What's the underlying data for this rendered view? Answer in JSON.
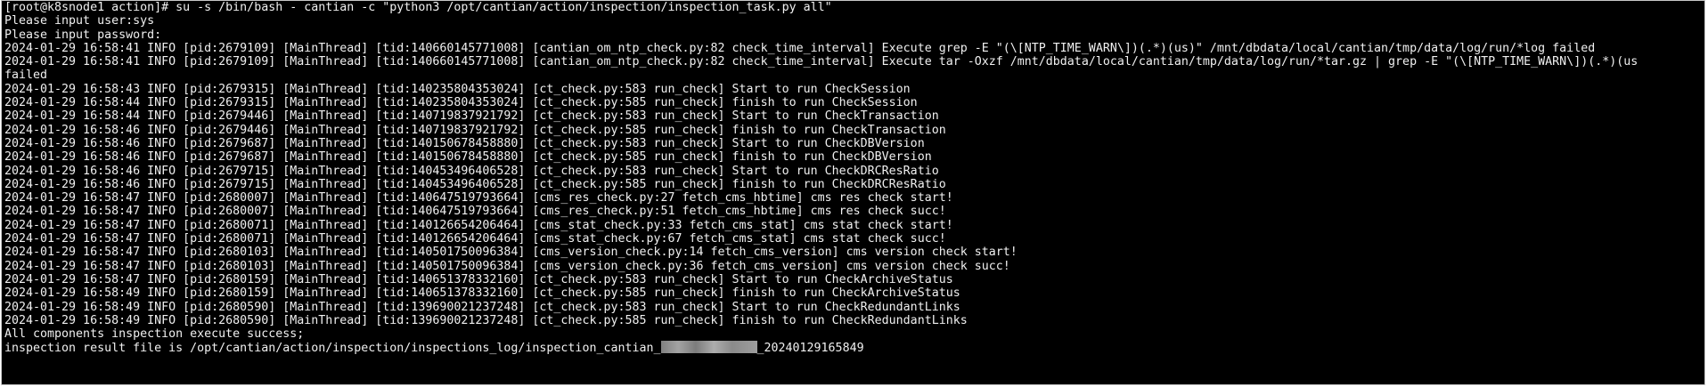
{
  "terminal": {
    "lines": [
      "[root@k8snode1 action]# su -s /bin/bash - cantian -c \"python3 /opt/cantian/action/inspection/inspection_task.py all\"",
      "Please input user:sys",
      "Please input password:",
      "2024-01-29 16:58:41 INFO [pid:2679109] [MainThread] [tid:140660145771008] [cantian_om_ntp_check.py:82 check_time_interval] Execute grep -E \"(\\[NTP_TIME_WARN\\])(.*)(us)\" /mnt/dbdata/local/cantian/tmp/data/log/run/*log failed",
      "2024-01-29 16:58:41 INFO [pid:2679109] [MainThread] [tid:140660145771008] [cantian_om_ntp_check.py:82 check_time_interval] Execute tar -Oxzf /mnt/dbdata/local/cantian/tmp/data/log/run/*tar.gz | grep -E \"(\\[NTP_TIME_WARN\\])(.*)(us",
      "failed",
      "2024-01-29 16:58:43 INFO [pid:2679315] [MainThread] [tid:140235804353024] [ct_check.py:583 run_check] Start to run CheckSession",
      "2024-01-29 16:58:44 INFO [pid:2679315] [MainThread] [tid:140235804353024] [ct_check.py:585 run_check] finish to run CheckSession",
      "2024-01-29 16:58:44 INFO [pid:2679446] [MainThread] [tid:140719837921792] [ct_check.py:583 run_check] Start to run CheckTransaction",
      "2024-01-29 16:58:46 INFO [pid:2679446] [MainThread] [tid:140719837921792] [ct_check.py:585 run_check] finish to run CheckTransaction",
      "2024-01-29 16:58:46 INFO [pid:2679687] [MainThread] [tid:140150678458880] [ct_check.py:583 run_check] Start to run CheckDBVersion",
      "2024-01-29 16:58:46 INFO [pid:2679687] [MainThread] [tid:140150678458880] [ct_check.py:585 run_check] finish to run CheckDBVersion",
      "2024-01-29 16:58:46 INFO [pid:2679715] [MainThread] [tid:140453496406528] [ct_check.py:583 run_check] Start to run CheckDRCResRatio",
      "2024-01-29 16:58:46 INFO [pid:2679715] [MainThread] [tid:140453496406528] [ct_check.py:585 run_check] finish to run CheckDRCResRatio",
      "2024-01-29 16:58:47 INFO [pid:2680007] [MainThread] [tid:140647519793664] [cms_res_check.py:27 fetch_cms_hbtime] cms res check start!",
      "2024-01-29 16:58:47 INFO [pid:2680007] [MainThread] [tid:140647519793664] [cms_res_check.py:51 fetch_cms_hbtime] cms res check succ!",
      "2024-01-29 16:58:47 INFO [pid:2680071] [MainThread] [tid:140126654206464] [cms_stat_check.py:33 fetch_cms_stat] cms stat check start!",
      "2024-01-29 16:58:47 INFO [pid:2680071] [MainThread] [tid:140126654206464] [cms_stat_check.py:67 fetch_cms_stat] cms stat check succ!",
      "2024-01-29 16:58:47 INFO [pid:2680103] [MainThread] [tid:140501750096384] [cms_version_check.py:14 fetch_cms_version] cms version check start!",
      "2024-01-29 16:58:47 INFO [pid:2680103] [MainThread] [tid:140501750096384] [cms_version_check.py:36 fetch_cms_version] cms version check succ!",
      "2024-01-29 16:58:47 INFO [pid:2680159] [MainThread] [tid:140651378332160] [ct_check.py:583 run_check] Start to run CheckArchiveStatus",
      "2024-01-29 16:58:49 INFO [pid:2680159] [MainThread] [tid:140651378332160] [ct_check.py:585 run_check] finish to run CheckArchiveStatus",
      "2024-01-29 16:58:49 INFO [pid:2680590] [MainThread] [tid:139690021237248] [ct_check.py:583 run_check] Start to run CheckRedundantLinks",
      "2024-01-29 16:58:49 INFO [pid:2680590] [MainThread] [tid:139690021237248] [ct_check.py:585 run_check] finish to run CheckRedundantLinks",
      "All components inspection execute success;"
    ],
    "result_prefix": "inspection result file is /opt/cantian/action/inspection/inspections_log/inspection_cantian_",
    "result_suffix": "_20240129165849"
  },
  "colors": {
    "background": "#000000",
    "foreground": "#f0f0f0",
    "frame_border": "#c8c8c8"
  }
}
